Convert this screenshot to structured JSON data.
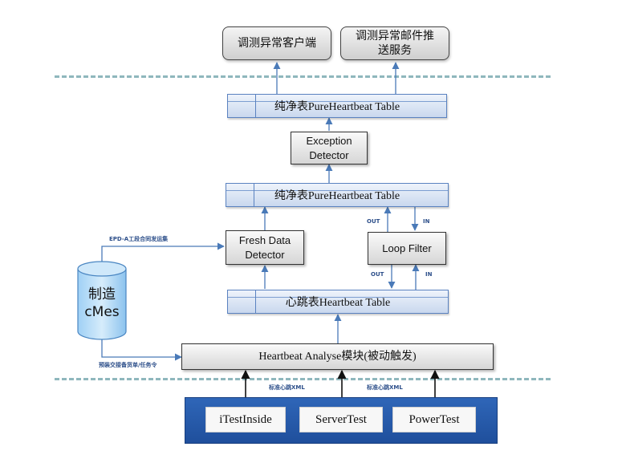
{
  "clients": {
    "client_app": "调测异常客户端",
    "mail_service": "调测异常邮件推送服务"
  },
  "tables": {
    "pure_top": "纯净表PureHeartbeat Table",
    "pure_mid": "纯净表PureHeartbeat Table",
    "heartbeat": "心跳表Heartbeat Table"
  },
  "processors": {
    "exception_detector": "Exception Detector",
    "fresh_data_detector": "Fresh Data Detector",
    "loop_filter": "Loop Filter",
    "analyse_module": "Heartbeat Analyse模块(被动触发)"
  },
  "database": {
    "label": "制造 cMes"
  },
  "edge_labels": {
    "epd_collect": "EPD-A工段合同发运集",
    "mes_to_analyse": "预装交接备货单/任务令",
    "std_xml_1": "标准心跳XML",
    "std_xml_2": "标准心跳XML",
    "out_upper": "OUT",
    "in_upper": "IN",
    "out_lower": "OUT",
    "in_lower": "IN"
  },
  "services": {
    "itest": "iTestInside",
    "server": "ServerTest",
    "power": "PowerTest"
  },
  "colors": {
    "arrow": "#4a7ab8",
    "dash": "#8fb7bd",
    "panel": "#2f66b8",
    "table_border": "#5a82c0"
  }
}
